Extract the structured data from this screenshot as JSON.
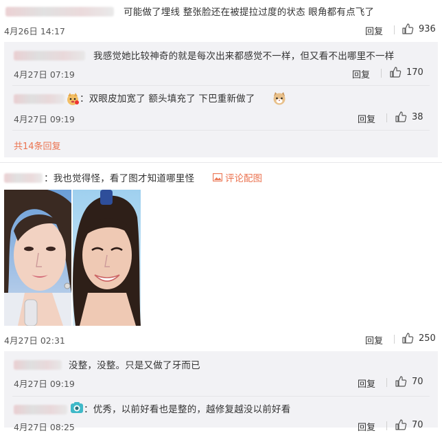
{
  "c0": {
    "text": "可能做了埋线 整张脸还在被提拉过度的状态 眼角都有点飞了",
    "time": "4月26日 14:17",
    "reply_label": "回复",
    "likes": "936"
  },
  "c0_replies": [
    {
      "text": "我感觉她比较神奇的就是每次出来都感觉不一样，但又看不出哪里不一样",
      "time": "4月27日 07:19",
      "reply_label": "回复",
      "likes": "170"
    },
    {
      "text": "：双眼皮加宽了  额头填充了  下巴重新做了",
      "time": "4月27日 09:19",
      "reply_label": "回复",
      "likes": "38"
    }
  ],
  "c0_more": "共14条回复",
  "c1": {
    "text": "：我也觉得怪，看了图才知道哪里怪",
    "pic_link": "评论配图",
    "time": "4月27日 02:31",
    "reply_label": "回复",
    "likes": "250"
  },
  "c1_replies": [
    {
      "text": "没整，没整。只是又做了牙而已",
      "time": "4月27日 09:19",
      "reply_label": "回复",
      "likes": "70"
    },
    {
      "text": "：优秀，以前好看也是整的，越修复越没以前好看",
      "time": "4月27日 08:25",
      "reply_label": "回复",
      "likes": "70"
    }
  ],
  "colors": {
    "accent": "#eb7350",
    "panel": "#f2f2f5",
    "text": "#333333",
    "meta": "#555555"
  },
  "icons": [
    "thumbs-up-icon",
    "picture-icon",
    "doge-emoji-icon",
    "cat-emoji-icon",
    "camera-emoji-icon"
  ]
}
